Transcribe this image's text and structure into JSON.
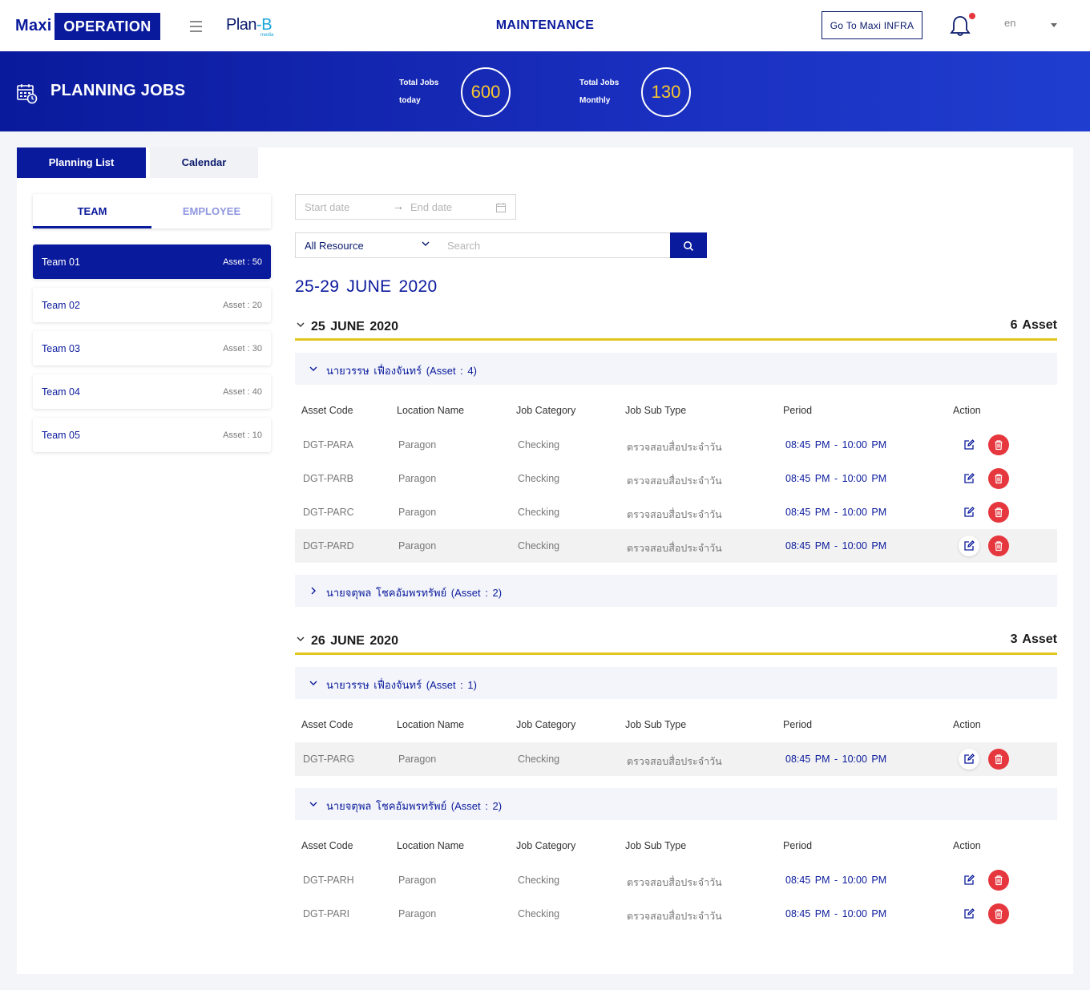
{
  "header": {
    "logo_maxi": "Maxi",
    "logo_operation": "OPERATION",
    "partner_logo_main": "Plan",
    "partner_logo_accent": "-B",
    "partner_logo_sub": "media",
    "title": "MAINTENANCE",
    "infra_button": "Go To Maxi INFRA",
    "language": "en",
    "notification_badge_color": "#e5373d"
  },
  "banner": {
    "title": "PLANNING JOBS",
    "icon": "calendar-clock-icon",
    "stats": [
      {
        "label_line1": "Total Jobs",
        "label_line2": "today",
        "value": "600"
      },
      {
        "label_line1": "Total Jobs",
        "label_line2": "Monthly",
        "value": "130"
      }
    ]
  },
  "tabs": [
    "Planning List",
    "Calendar"
  ],
  "sidebar": {
    "tabs": [
      "TEAM",
      "EMPLOYEE"
    ],
    "teams": [
      {
        "name": "Team 01",
        "asset": "Asset : 50",
        "active": true
      },
      {
        "name": "Team 02",
        "asset": "Asset : 20",
        "active": false
      },
      {
        "name": "Team 03",
        "asset": "Asset : 30",
        "active": false
      },
      {
        "name": "Team 04",
        "asset": "Asset : 40",
        "active": false
      },
      {
        "name": "Team 05",
        "asset": "Asset : 10",
        "active": false
      }
    ]
  },
  "filters": {
    "start_placeholder": "Start date",
    "end_placeholder": "End date",
    "resource": "All Resource",
    "search_placeholder": "Search"
  },
  "range_title": "25-29 JUNE 2020",
  "columns": [
    "Asset Code",
    "Location Name",
    "Job Category",
    "Job Sub Type",
    "Period",
    "Action"
  ],
  "days": [
    {
      "date": "25 JUNE 2020",
      "count": "6 Asset",
      "groups": [
        {
          "name": "นายวรรษ เฟื่องจันทร์ (Asset : 4)",
          "expanded": true,
          "rows": [
            {
              "code": "DGT-PARA",
              "location": "Paragon",
              "category": "Checking",
              "subtype": "ตรวจสอบสื่อประจำวัน",
              "period": "08:45 PM - 10:00 PM"
            },
            {
              "code": "DGT-PARB",
              "location": "Paragon",
              "category": "Checking",
              "subtype": "ตรวจสอบสื่อประจำวัน",
              "period": "08:45 PM - 10:00 PM"
            },
            {
              "code": "DGT-PARC",
              "location": "Paragon",
              "category": "Checking",
              "subtype": "ตรวจสอบสื่อประจำวัน",
              "period": "08:45 PM - 10:00 PM"
            },
            {
              "code": "DGT-PARD",
              "location": "Paragon",
              "category": "Checking",
              "subtype": "ตรวจสอบสื่อประจำวัน",
              "period": "08:45 PM - 10:00 PM"
            }
          ]
        },
        {
          "name": "นายจตุพล โชคอัมพรทรัพย์ (Asset : 2)",
          "expanded": false,
          "rows": []
        }
      ]
    },
    {
      "date": "26 JUNE 2020",
      "count": "3 Asset",
      "groups": [
        {
          "name": "นายวรรษ เฟื่องจันทร์ (Asset : 1)",
          "expanded": true,
          "rows": [
            {
              "code": "DGT-PARG",
              "location": "Paragon",
              "category": "Checking",
              "subtype": "ตรวจสอบสื่อประจำวัน",
              "period": "08:45 PM - 10:00 PM"
            }
          ]
        },
        {
          "name": "นายจตุพล โชคอัมพรทรัพย์ (Asset : 2)",
          "expanded": true,
          "rows": [
            {
              "code": "DGT-PARH",
              "location": "Paragon",
              "category": "Checking",
              "subtype": "ตรวจสอบสื่อประจำวัน",
              "period": "08:45 PM - 10:00 PM"
            },
            {
              "code": "DGT-PARI",
              "location": "Paragon",
              "category": "Checking",
              "subtype": "ตรวจสอบสื่อประจำวัน",
              "period": "08:45 PM - 10:00 PM"
            }
          ]
        }
      ]
    }
  ],
  "colors": {
    "primary": "#0a1a9c",
    "accent_yellow": "#e3c520",
    "stat_value": "#f7c631",
    "delete": "#e5373d"
  }
}
